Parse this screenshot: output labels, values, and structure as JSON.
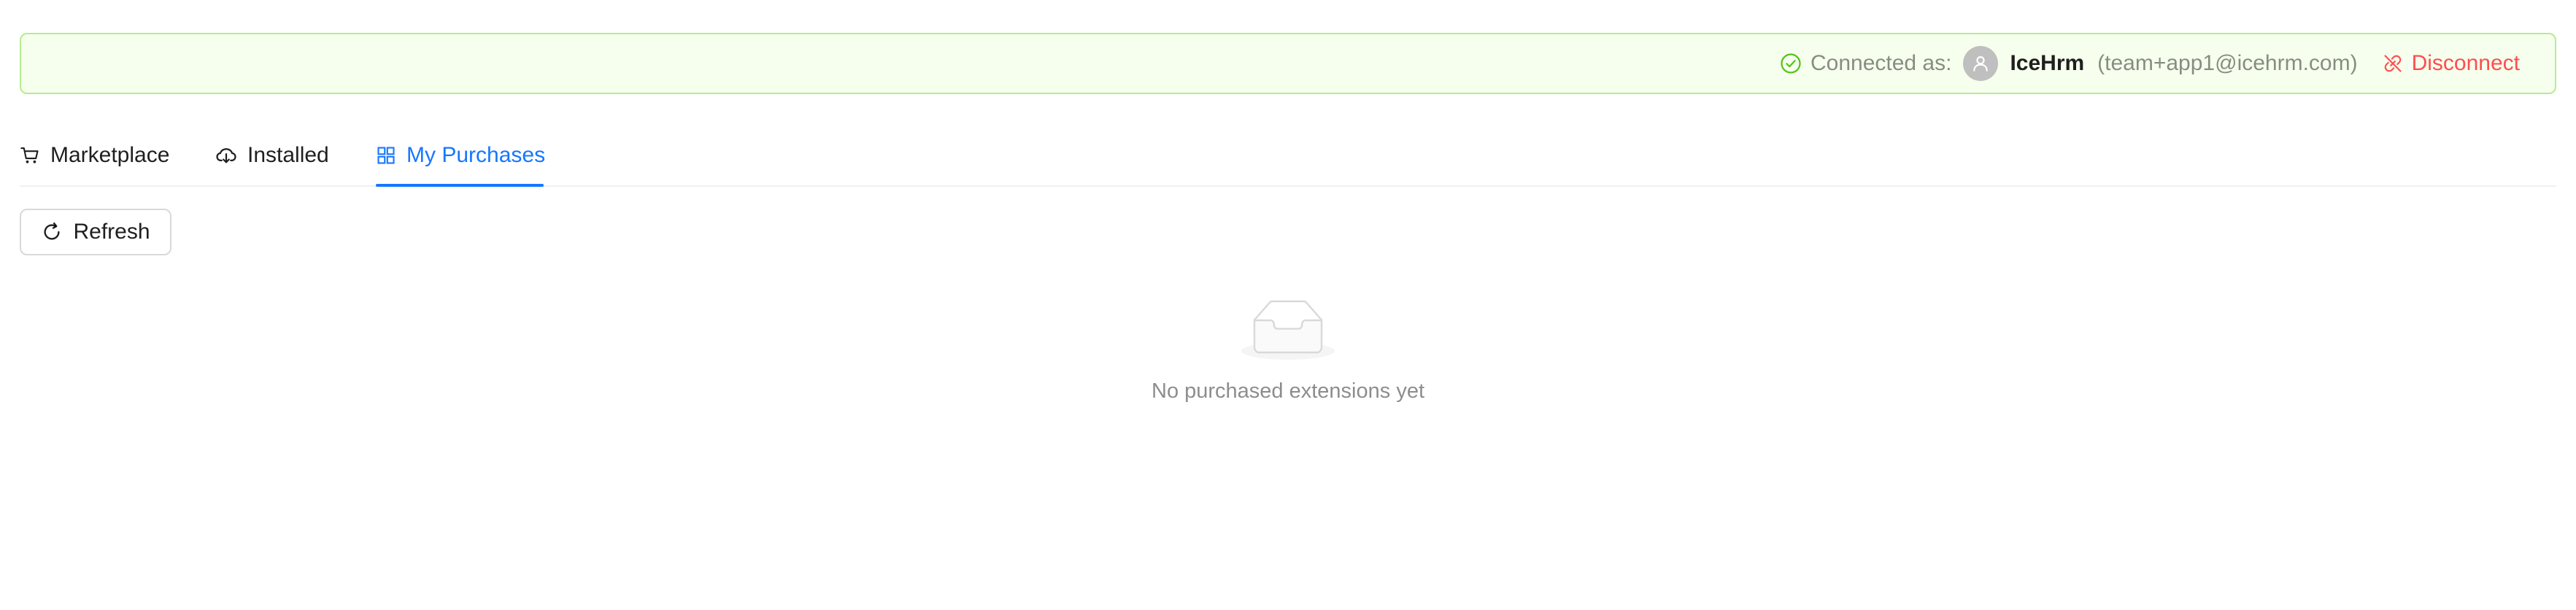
{
  "connection": {
    "label": "Connected as:",
    "user_name": "IceHrm",
    "user_email": "(team+app1@icehrm.com)",
    "disconnect_label": "Disconnect",
    "status_color": "#52c41a",
    "danger_color": "#ff4d4f"
  },
  "tabs": [
    {
      "label": "Marketplace",
      "icon": "shopping-cart-icon",
      "active": false
    },
    {
      "label": "Installed",
      "icon": "cloud-download-icon",
      "active": false
    },
    {
      "label": "My Purchases",
      "icon": "appstore-icon",
      "active": true
    }
  ],
  "toolbar": {
    "refresh_label": "Refresh",
    "refresh_icon": "reload-icon"
  },
  "empty_state": {
    "icon": "empty-inbox-icon",
    "text": "No purchased extensions yet"
  },
  "colors": {
    "accent": "#1677ff",
    "banner_bg": "#f6ffed",
    "banner_border": "#b7eb8f"
  }
}
